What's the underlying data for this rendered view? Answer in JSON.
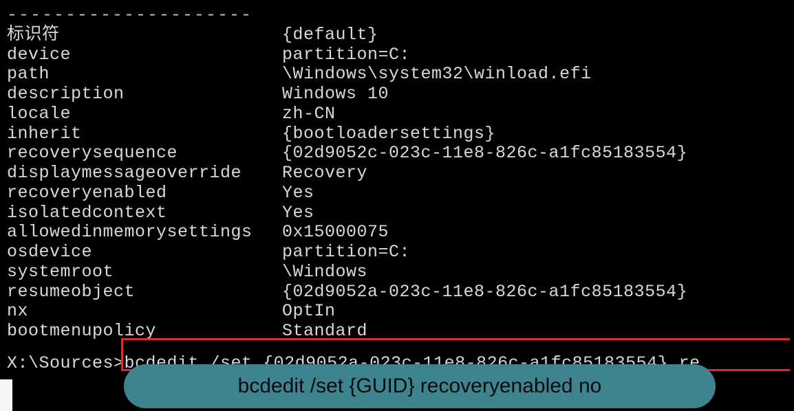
{
  "terminal": {
    "divider": "---------------------",
    "entries": [
      {
        "key": "标识符",
        "value": "{default}"
      },
      {
        "key": "device",
        "value": "partition=C:"
      },
      {
        "key": "path",
        "value": "\\Windows\\system32\\winload.efi"
      },
      {
        "key": "description",
        "value": "Windows 10"
      },
      {
        "key": "locale",
        "value": "zh-CN"
      },
      {
        "key": "inherit",
        "value": "{bootloadersettings}"
      },
      {
        "key": "recoverysequence",
        "value": "{02d9052c-023c-11e8-826c-a1fc85183554}"
      },
      {
        "key": "displaymessageoverride",
        "value": "Recovery"
      },
      {
        "key": "recoveryenabled",
        "value": "Yes"
      },
      {
        "key": "isolatedcontext",
        "value": "Yes"
      },
      {
        "key": "allowedinmemorysettings",
        "value": "0x15000075"
      },
      {
        "key": "osdevice",
        "value": "partition=C:"
      },
      {
        "key": "systemroot",
        "value": "\\Windows"
      },
      {
        "key": "resumeobject",
        "value": "{02d9052a-023c-11e8-826c-a1fc85183554}"
      },
      {
        "key": "nx",
        "value": "OptIn"
      },
      {
        "key": "bootmenupolicy",
        "value": "Standard"
      }
    ],
    "prompt": "X:\\Sources>",
    "typed_command": "bcdedit /set {02d9052a-023c-11e8-826c-a1fc85183554} re"
  },
  "callout": {
    "text": "bcdedit /set {GUID} recoveryenabled no"
  }
}
